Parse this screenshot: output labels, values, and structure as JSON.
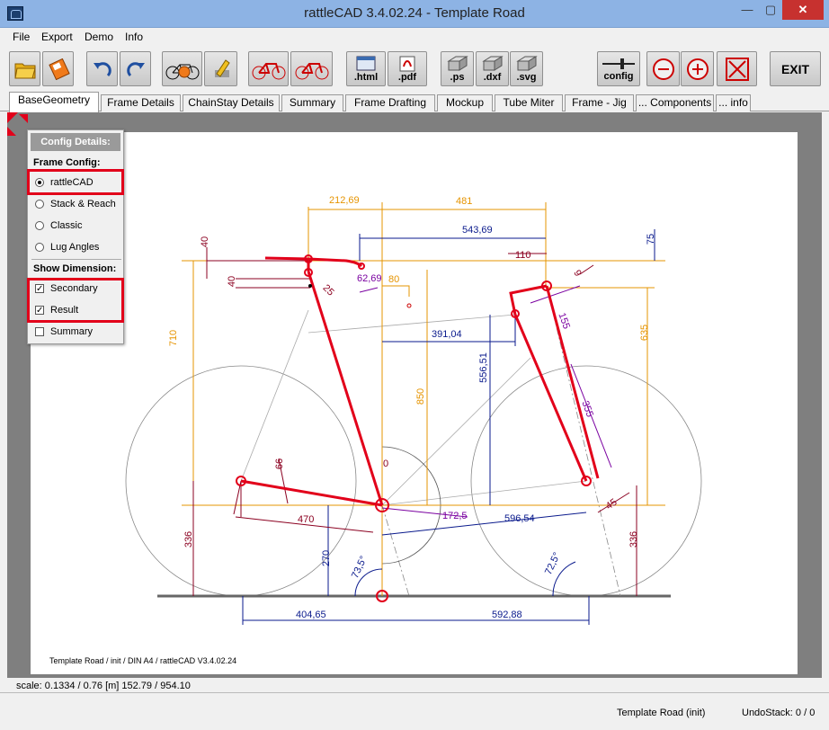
{
  "window": {
    "title": "rattleCAD  3.4.02.24 - Template Road",
    "minimize": "—",
    "maximize": "▢",
    "close": "✕"
  },
  "menu": [
    "File",
    "Export",
    "Demo",
    "Info"
  ],
  "toolbar": {
    "html": ".html",
    "pdf": ".pdf",
    "ps": ".ps",
    "dxf": ".dxf",
    "svg": ".svg",
    "config": "config",
    "exit": "EXIT",
    "icons": [
      "folder-open-icon",
      "save-icon",
      "undo-icon",
      "redo-icon",
      "bike-gear-icon",
      "pencil-icon",
      "bike-red-icon",
      "bike-red-icon-2",
      "html-export-icon",
      "pdf-export-icon",
      "ps-print-icon",
      "dxf-print-icon",
      "svg-print-icon",
      "config-slider-icon",
      "zoom-out-icon",
      "zoom-in-icon",
      "fit-screen-icon"
    ]
  },
  "tabs": [
    "BaseGeometry",
    "Frame Details",
    "ChainStay Details",
    "Summary",
    "Frame Drafting",
    "Mockup",
    "Tube Miter",
    "Frame - Jig",
    "... Components",
    "... info"
  ],
  "config": {
    "title": "Config Details:",
    "frame_header": "Frame Config:",
    "frame_options": [
      "rattleCAD",
      "Stack & Reach",
      "Classic",
      "Lug Angles"
    ],
    "dim_header": "Show Dimension:",
    "dim_options": [
      "Secondary",
      "Result",
      "Summary"
    ]
  },
  "dimensions": {
    "d212": "212,69",
    "d481": "481",
    "d543": "543,69",
    "d75": "75",
    "d40a": "40",
    "d40b": "40",
    "d25": "25",
    "d6269": "62,69",
    "d80": "80",
    "d110": "110",
    "d9": "9",
    "d710": "710",
    "d635": "635",
    "d391": "391,04",
    "d556": "556,51",
    "d850": "850",
    "d155": "155",
    "d66": "66",
    "d0": "0",
    "d470": "470",
    "d1725": "172,5",
    "d59654": "596,54",
    "d45": "45",
    "d336a": "336",
    "d336b": "336",
    "d270": "270",
    "d735": "73,5°",
    "d725": "72,5°",
    "d40465": "404,65",
    "d59288": "592,88",
    "d355": "355"
  },
  "footer": {
    "note": "Template Road  /  init  / DIN A4 /  rattleCAD  V3.4.02.24"
  },
  "status": {
    "scale": "scale: 0.1334 / 0.76  [m]  152.79 / 954.10",
    "template": "Template Road (init)",
    "undo": "UndoStack:  0 / 0"
  },
  "colors": {
    "frame": "#e2001a",
    "orange_dim": "#e69400",
    "blue_dim": "#0a1a8c",
    "dark_red_dim": "#8b0020",
    "purple_dim": "#7a00a0",
    "titlebar": "#8db3e4"
  }
}
